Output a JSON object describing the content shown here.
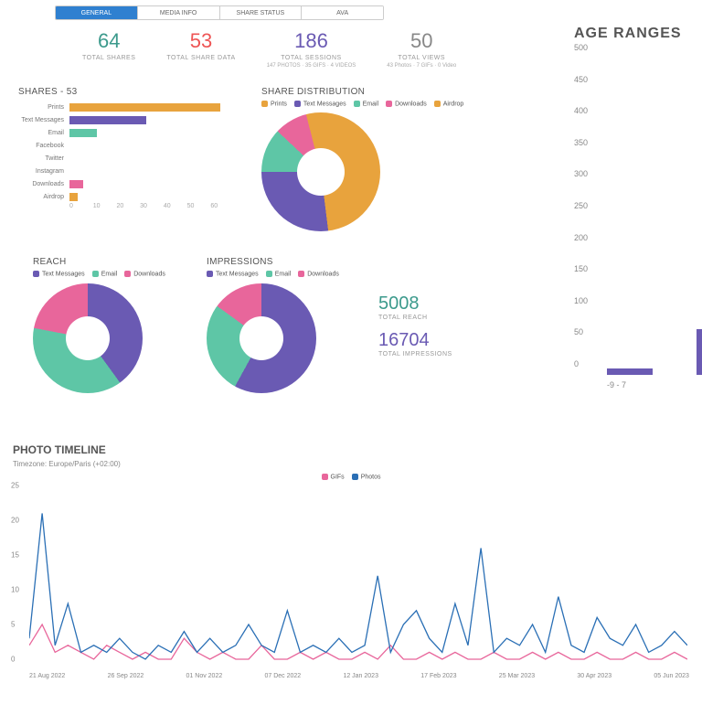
{
  "tabs": [
    "GENERAL",
    "MEDIA INFO",
    "SHARE STATUS",
    "AVA"
  ],
  "active_tab": 0,
  "kpis": [
    {
      "value": "64",
      "label": "TOTAL SHARES",
      "color": "teal"
    },
    {
      "value": "53",
      "label": "TOTAL SHARE DATA",
      "color": "red"
    },
    {
      "value": "186",
      "label": "TOTAL SESSIONS",
      "sub": "147 PHOTOS · 35 GIFS · 4 VIDEOS",
      "color": "purple"
    },
    {
      "value": "50",
      "label": "TOTAL VIEWS",
      "sub": "43 Photos · 7 GIFs · 0 Video",
      "color": "grey"
    }
  ],
  "shares_title": "SHARES - 53",
  "share_dist_title": "SHARE DISTRIBUTION",
  "reach_title": "REACH",
  "impr_title": "IMPRESSIONS",
  "totals": {
    "reach_val": "5008",
    "reach_lbl": "TOTAL REACH",
    "impr_val": "16704",
    "impr_lbl": "TOTAL IMPRESSIONS"
  },
  "age_title": "AGE RANGES",
  "timeline_title": "PHOTO TIMELINE",
  "timeline_tz": "Timezone: Europe/Paris (+02:00)",
  "timeline_legend": [
    {
      "name": "GIFs",
      "color": "#e8669b"
    },
    {
      "name": "Photos",
      "color": "#2a6fb5"
    }
  ],
  "chart_data": [
    {
      "id": "shares_bar",
      "type": "bar",
      "title": "SHARES - 53",
      "categories": [
        "Prints",
        "Text Messages",
        "Email",
        "Facebook",
        "Twitter",
        "Instagram",
        "Downloads",
        "Airdrop"
      ],
      "values": [
        55,
        28,
        10,
        0,
        0,
        0,
        5,
        3
      ],
      "colors": [
        "#e8a33d",
        "#6a5ab3",
        "#5ec6a6",
        "#6a5ab3",
        "#5ec6a6",
        "#e8a33d",
        "#e8669b",
        "#e8a33d"
      ],
      "xticks": [
        0,
        10,
        20,
        30,
        40,
        50,
        60
      ],
      "xlim": [
        0,
        60
      ]
    },
    {
      "id": "share_dist",
      "type": "pie",
      "title": "SHARE DISTRIBUTION",
      "series": [
        {
          "name": "Prints",
          "value": 48,
          "color": "#e8a33d"
        },
        {
          "name": "Text Messages",
          "value": 27,
          "color": "#6a5ab3"
        },
        {
          "name": "Email",
          "value": 12,
          "color": "#5ec6a6"
        },
        {
          "name": "Downloads",
          "value": 9,
          "color": "#e8669b"
        },
        {
          "name": "Airdrop",
          "value": 4,
          "color": "#e8a33d"
        }
      ]
    },
    {
      "id": "reach",
      "type": "pie",
      "title": "REACH",
      "series": [
        {
          "name": "Text Messages",
          "value": 40,
          "color": "#6a5ab3"
        },
        {
          "name": "Email",
          "value": 38,
          "color": "#5ec6a6"
        },
        {
          "name": "Downloads",
          "value": 22,
          "color": "#e8669b"
        }
      ]
    },
    {
      "id": "impressions",
      "type": "pie",
      "title": "IMPRESSIONS",
      "series": [
        {
          "name": "Text Messages",
          "value": 58,
          "color": "#6a5ab3"
        },
        {
          "name": "Email",
          "value": 27,
          "color": "#5ec6a6"
        },
        {
          "name": "Downloads",
          "value": 15,
          "color": "#e8669b"
        }
      ]
    },
    {
      "id": "age_ranges",
      "type": "bar",
      "title": "AGE RANGES",
      "categories": [
        "-9 - 7"
      ],
      "values": [
        10
      ],
      "ylim": [
        0,
        500
      ],
      "yticks": [
        0,
        50,
        100,
        150,
        200,
        250,
        300,
        350,
        400,
        450,
        500
      ]
    },
    {
      "id": "photo_timeline",
      "type": "line",
      "title": "PHOTO TIMELINE",
      "xlabel": "",
      "ylabel": "",
      "ylim": [
        0,
        25
      ],
      "yticks": [
        0,
        5,
        10,
        15,
        20,
        25
      ],
      "x_labels": [
        "21 Aug 2022",
        "26 Sep 2022",
        "01 Nov 2022",
        "07 Dec 2022",
        "12 Jan 2023",
        "17 Feb 2023",
        "25 Mar 2023",
        "30 Apr 2023",
        "05 Jun 2023"
      ],
      "series": [
        {
          "name": "GIFs",
          "color": "#e8669b",
          "values": [
            2,
            5,
            1,
            2,
            1,
            0,
            2,
            1,
            0,
            1,
            0,
            0,
            3,
            1,
            0,
            1,
            0,
            0,
            2,
            0,
            0,
            1,
            0,
            1,
            0,
            0,
            1,
            0,
            2,
            0,
            0,
            1,
            0,
            1,
            0,
            0,
            1,
            0,
            0,
            1,
            0,
            1,
            0,
            0,
            1,
            0,
            0,
            1,
            0,
            0,
            1,
            0
          ]
        },
        {
          "name": "Photos",
          "color": "#2a6fb5",
          "values": [
            3,
            21,
            2,
            8,
            1,
            2,
            1,
            3,
            1,
            0,
            2,
            1,
            4,
            1,
            3,
            1,
            2,
            5,
            2,
            1,
            7,
            1,
            2,
            1,
            3,
            1,
            2,
            12,
            1,
            5,
            7,
            3,
            1,
            8,
            2,
            16,
            1,
            3,
            2,
            5,
            1,
            9,
            2,
            1,
            6,
            3,
            2,
            5,
            1,
            2,
            4,
            2
          ]
        }
      ]
    }
  ]
}
